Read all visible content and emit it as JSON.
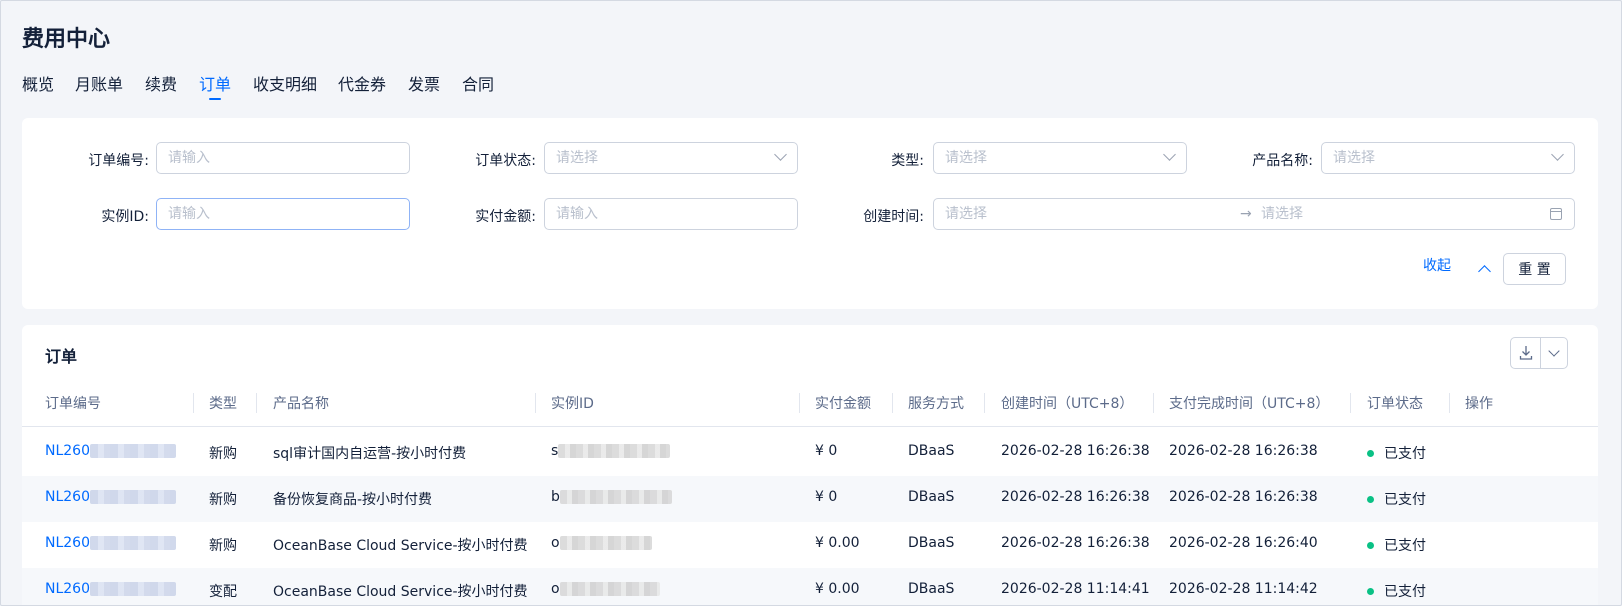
{
  "page": {
    "title": "费用中心"
  },
  "tabs": [
    {
      "label": "概览"
    },
    {
      "label": "月账单"
    },
    {
      "label": "续费"
    },
    {
      "label": "订单",
      "active": true
    },
    {
      "label": "收支明细"
    },
    {
      "label": "代金券"
    },
    {
      "label": "发票"
    },
    {
      "label": "合同"
    }
  ],
  "filters": {
    "order_no": {
      "label": "订单编号:",
      "placeholder": "请输入"
    },
    "order_status": {
      "label": "订单状态:",
      "placeholder": "请选择"
    },
    "type": {
      "label": "类型:",
      "placeholder": "请选择"
    },
    "product_name": {
      "label": "产品名称:",
      "placeholder": "请选择"
    },
    "instance_id": {
      "label": "实例ID:",
      "placeholder": "请输入"
    },
    "paid_amount": {
      "label": "实付金额:",
      "placeholder": "请输入"
    },
    "create_time": {
      "label": "创建时间:",
      "start_placeholder": "请选择",
      "arrow": "→",
      "end_placeholder": "请选择"
    },
    "collapse_label": "收起",
    "reset_label": "重 置"
  },
  "table": {
    "title": "订单",
    "columns": [
      "订单编号",
      "类型",
      "产品名称",
      "实例ID",
      "实付金额",
      "服务方式",
      "创建时间（UTC+8）",
      "支付完成时间（UTC+8）",
      "订单状态",
      "操作"
    ],
    "rows": [
      {
        "order_no": "NL260",
        "type": "新购",
        "product": "sql审计国内自运营-按小时付费",
        "instance": "s",
        "amount": "¥ 0",
        "service": "DBaaS",
        "created": "2026-02-28 16:26:38",
        "paid": "2026-02-28 16:26:38",
        "status": "已支付"
      },
      {
        "order_no": "NL260",
        "type": "新购",
        "product": "备份恢复商品-按小时付费",
        "instance": "b",
        "amount": "¥ 0",
        "service": "DBaaS",
        "created": "2026-02-28 16:26:38",
        "paid": "2026-02-28 16:26:38",
        "status": "已支付"
      },
      {
        "order_no": "NL260",
        "type": "新购",
        "product": "OceanBase Cloud Service-按小时付费",
        "instance": "o",
        "amount": "¥ 0.00",
        "service": "DBaaS",
        "created": "2026-02-28 16:26:38",
        "paid": "2026-02-28 16:26:40",
        "status": "已支付"
      },
      {
        "order_no": "NL260",
        "type": "变配",
        "product": "OceanBase Cloud Service-按小时付费",
        "instance": "o",
        "amount": "¥ 0.00",
        "service": "DBaaS",
        "created": "2026-02-28 11:14:41",
        "paid": "2026-02-28 11:14:42",
        "status": "已支付"
      }
    ]
  },
  "colors": {
    "accent": "#006aff",
    "status_paid": "#0ac185",
    "text": "#132039",
    "muted": "#5c6b8a"
  }
}
